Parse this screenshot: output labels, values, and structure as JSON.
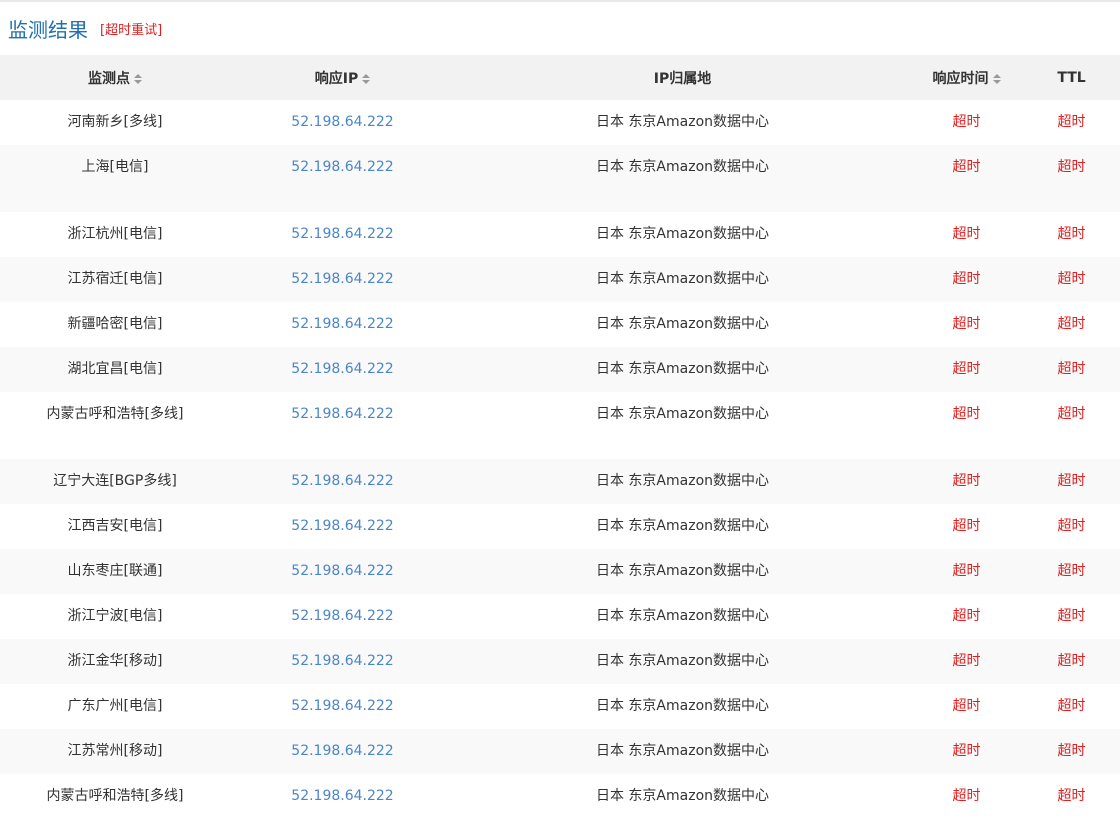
{
  "header": {
    "title": "监测结果",
    "retry_label": "[超时重试]"
  },
  "table": {
    "columns": [
      {
        "label": "监测点",
        "sortable": true
      },
      {
        "label": "响应IP",
        "sortable": true
      },
      {
        "label": "IP归属地",
        "sortable": false
      },
      {
        "label": "响应时间",
        "sortable": true
      },
      {
        "label": "TTL",
        "sortable": false
      }
    ],
    "rows": [
      {
        "location": "河南新乡[多线]",
        "ip": "52.198.64.222",
        "geo": "日本 东京Amazon数据中心",
        "response_time": "超时",
        "ttl": "超时"
      },
      {
        "location": "上海[电信]",
        "ip": "52.198.64.222",
        "geo": "日本 东京Amazon数据中心",
        "response_time": "超时",
        "ttl": "超时"
      },
      {
        "location": "浙江杭州[电信]",
        "ip": "52.198.64.222",
        "geo": "日本 东京Amazon数据中心",
        "response_time": "超时",
        "ttl": "超时"
      },
      {
        "location": "江苏宿迁[电信]",
        "ip": "52.198.64.222",
        "geo": "日本 东京Amazon数据中心",
        "response_time": "超时",
        "ttl": "超时"
      },
      {
        "location": "新疆哈密[电信]",
        "ip": "52.198.64.222",
        "geo": "日本 东京Amazon数据中心",
        "response_time": "超时",
        "ttl": "超时"
      },
      {
        "location": "湖北宜昌[电信]",
        "ip": "52.198.64.222",
        "geo": "日本 东京Amazon数据中心",
        "response_time": "超时",
        "ttl": "超时"
      },
      {
        "location": "内蒙古呼和浩特[多线]",
        "ip": "52.198.64.222",
        "geo": "日本 东京Amazon数据中心",
        "response_time": "超时",
        "ttl": "超时"
      },
      {
        "location": "辽宁大连[BGP多线]",
        "ip": "52.198.64.222",
        "geo": "日本 东京Amazon数据中心",
        "response_time": "超时",
        "ttl": "超时"
      },
      {
        "location": "江西吉安[电信]",
        "ip": "52.198.64.222",
        "geo": "日本 东京Amazon数据中心",
        "response_time": "超时",
        "ttl": "超时"
      },
      {
        "location": "山东枣庄[联通]",
        "ip": "52.198.64.222",
        "geo": "日本 东京Amazon数据中心",
        "response_time": "超时",
        "ttl": "超时"
      },
      {
        "location": "浙江宁波[电信]",
        "ip": "52.198.64.222",
        "geo": "日本 东京Amazon数据中心",
        "response_time": "超时",
        "ttl": "超时"
      },
      {
        "location": "浙江金华[移动]",
        "ip": "52.198.64.222",
        "geo": "日本 东京Amazon数据中心",
        "response_time": "超时",
        "ttl": "超时"
      },
      {
        "location": "广东广州[电信]",
        "ip": "52.198.64.222",
        "geo": "日本 东京Amazon数据中心",
        "response_time": "超时",
        "ttl": "超时"
      },
      {
        "location": "江苏常州[移动]",
        "ip": "52.198.64.222",
        "geo": "日本 东京Amazon数据中心",
        "response_time": "超时",
        "ttl": "超时"
      },
      {
        "location": "内蒙古呼和浩特[多线]",
        "ip": "52.198.64.222",
        "geo": "日本 东京Amazon数据中心",
        "response_time": "超时",
        "ttl": "超时"
      }
    ]
  },
  "colors": {
    "title": "#1f6fb2",
    "ip_link": "#4a86c8",
    "timeout": "#e02020",
    "header_bg": "#f2f2f2",
    "stripe_bg": "#f9f9f9"
  },
  "icons": {
    "sort": "sort-icon"
  }
}
